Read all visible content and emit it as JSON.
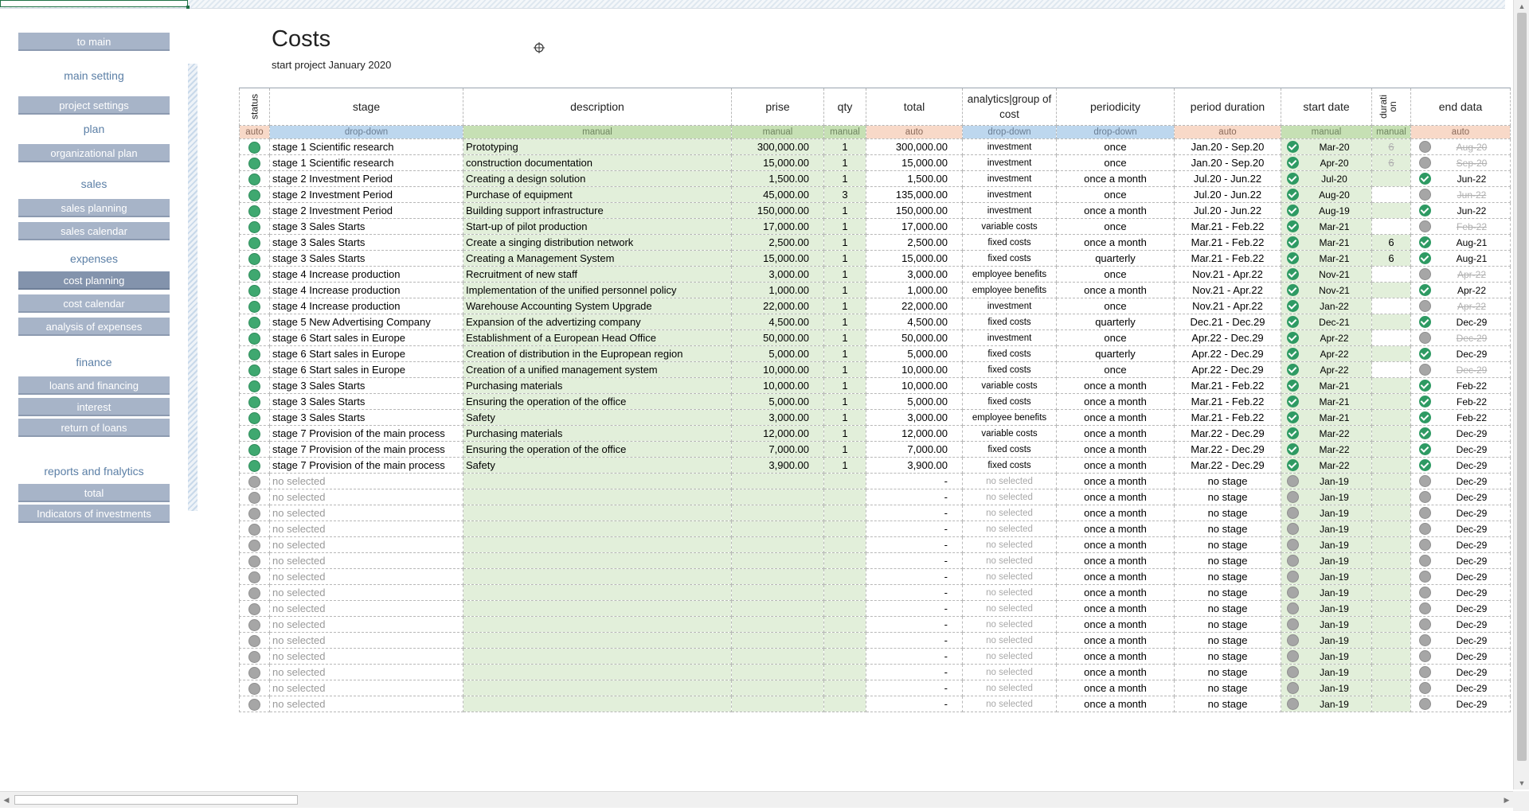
{
  "nav": {
    "to_main": "to main",
    "main_setting": "main setting",
    "project_settings": "project settings",
    "plan": "plan",
    "organizational_plan": "organizational plan",
    "sales": "sales",
    "sales_planning": "sales planning",
    "sales_calendar": "sales calendar",
    "expenses": "expenses",
    "cost_planning": "cost planning",
    "cost_calendar": "cost calendar",
    "analysis_of_expenses": "analysis of expenses",
    "finance": "finance",
    "loans_and_financing": "loans and financing",
    "interest": "interest",
    "return_of_loans": "return of loans",
    "reports": "reports and fnalytics",
    "total": "total",
    "indicators": "Indicators of investments"
  },
  "page": {
    "title": "Costs",
    "subtitle": "start project January 2020"
  },
  "columns": {
    "status": "status",
    "stage": "stage",
    "description": "description",
    "prise": "prise",
    "qty": "qty",
    "total": "total",
    "analytics": "analytics|group of cost",
    "periodicity": "periodicity",
    "period_duration": "period duration",
    "start_date": "start date",
    "duration": "durati on",
    "end_date": "end data"
  },
  "types": {
    "auto": "auto",
    "drop": "drop-down",
    "manual": "manual"
  },
  "colors": {
    "accent_nav": "#a7b4c8",
    "status_green": "#3fa870",
    "status_grey": "#a6a6a6",
    "manual_fill": "#e2efda",
    "auto_fill": "#f8d9c8",
    "drop_fill": "#bdd7ee"
  },
  "rows": [
    {
      "stage": "stage 1 Scientific research",
      "description": "Prototyping",
      "prise": "300,000.00",
      "qty": "1",
      "total": "300,000.00",
      "group": "investment",
      "periodicity": "once",
      "duration_range": "Jan.20 - Sep.20",
      "start": "Mar-20",
      "dur": "6",
      "end": "Aug-20",
      "end_struck": true,
      "dur_struck": true,
      "end_green": false
    },
    {
      "stage": "stage 1 Scientific research",
      "description": "construction documentation",
      "prise": "15,000.00",
      "qty": "1",
      "total": "15,000.00",
      "group": "investment",
      "periodicity": "once",
      "duration_range": "Jan.20 - Sep.20",
      "start": "Apr-20",
      "dur": "6",
      "end": "Sep-20",
      "end_struck": true,
      "dur_struck": true,
      "end_green": false
    },
    {
      "stage": "stage 2 Investment Period",
      "description": "Creating a design solution",
      "prise": "1,500.00",
      "qty": "1",
      "total": "1,500.00",
      "group": "investment",
      "periodicity": "once a month",
      "duration_range": "Jul.20 - Jun.22",
      "start": "Jul-20",
      "dur": "",
      "end": "Jun-22",
      "end_struck": false,
      "dur_struck": false,
      "end_green": true
    },
    {
      "stage": "stage 2 Investment Period",
      "description": "Purchase of equipment",
      "prise": "45,000.00",
      "qty": "3",
      "total": "135,000.00",
      "group": "investment",
      "periodicity": "once",
      "duration_range": "Jul.20 - Jun.22",
      "start": "Aug-20",
      "dur": "",
      "end": "Jun-22",
      "end_struck": true,
      "dur_struck": false,
      "end_green": false
    },
    {
      "stage": "stage 2 Investment Period",
      "description": "Building support infrastructure",
      "prise": "150,000.00",
      "qty": "1",
      "total": "150,000.00",
      "group": "investment",
      "periodicity": "once a month",
      "duration_range": "Jul.20 - Jun.22",
      "start": "Aug-19",
      "dur": "",
      "end": "Jun-22",
      "end_struck": false,
      "dur_struck": false,
      "end_green": true
    },
    {
      "stage": "stage 3 Sales Starts",
      "description": "Start-up of pilot production",
      "prise": "17,000.00",
      "qty": "1",
      "total": "17,000.00",
      "group": "variable costs",
      "periodicity": "once",
      "duration_range": "Mar.21 - Feb.22",
      "start": "Mar-21",
      "dur": "",
      "end": "Feb-22",
      "end_struck": true,
      "dur_struck": false,
      "end_green": false
    },
    {
      "stage": "stage 3 Sales Starts",
      "description": "Create a singing distribution network",
      "prise": "2,500.00",
      "qty": "1",
      "total": "2,500.00",
      "group": "fixed costs",
      "periodicity": "once a month",
      "duration_range": "Mar.21 - Feb.22",
      "start": "Mar-21",
      "dur": "6",
      "end": "Aug-21",
      "end_struck": false,
      "dur_struck": false,
      "end_green": true
    },
    {
      "stage": "stage 3 Sales Starts",
      "description": "Creating a Management System",
      "prise": "15,000.00",
      "qty": "1",
      "total": "15,000.00",
      "group": "fixed costs",
      "periodicity": "quarterly",
      "duration_range": "Mar.21 - Feb.22",
      "start": "Mar-21",
      "dur": "6",
      "end": "Aug-21",
      "end_struck": false,
      "dur_struck": false,
      "end_green": true
    },
    {
      "stage": "stage 4 Increase production",
      "description": "Recruitment of new staff",
      "prise": "3,000.00",
      "qty": "1",
      "total": "3,000.00",
      "group": "employee benefits",
      "periodicity": "once",
      "duration_range": "Nov.21 - Apr.22",
      "start": "Nov-21",
      "dur": "",
      "end": "Apr-22",
      "end_struck": true,
      "dur_struck": false,
      "end_green": false
    },
    {
      "stage": "stage 4 Increase production",
      "description": "Implementation of the unified personnel policy",
      "prise": "1,000.00",
      "qty": "1",
      "total": "1,000.00",
      "group": "employee benefits",
      "periodicity": "once a month",
      "duration_range": "Nov.21 - Apr.22",
      "start": "Nov-21",
      "dur": "",
      "end": "Apr-22",
      "end_struck": false,
      "dur_struck": false,
      "end_green": true
    },
    {
      "stage": "stage 4 Increase production",
      "description": "Warehouse Accounting System Upgrade",
      "prise": "22,000.00",
      "qty": "1",
      "total": "22,000.00",
      "group": "investment",
      "periodicity": "once",
      "duration_range": "Nov.21 - Apr.22",
      "start": "Jan-22",
      "dur": "",
      "end": "Apr-22",
      "end_struck": true,
      "dur_struck": false,
      "end_green": false
    },
    {
      "stage": "stage 5 New Advertising Company",
      "description": "Expansion of the advertizing company",
      "prise": "4,500.00",
      "qty": "1",
      "total": "4,500.00",
      "group": "fixed costs",
      "periodicity": "quarterly",
      "duration_range": "Dec.21 - Dec.29",
      "start": "Dec-21",
      "dur": "",
      "end": "Dec-29",
      "end_struck": false,
      "dur_struck": false,
      "end_green": true
    },
    {
      "stage": "stage 6 Start sales in Europe",
      "description": "Establishment of a European Head Office",
      "prise": "50,000.00",
      "qty": "1",
      "total": "50,000.00",
      "group": "investment",
      "periodicity": "once",
      "duration_range": "Apr.22 - Dec.29",
      "start": "Apr-22",
      "dur": "",
      "end": "Dec-29",
      "end_struck": true,
      "dur_struck": false,
      "end_green": false
    },
    {
      "stage": "stage 6 Start sales in Europe",
      "description": "Creation of distribution in the Eupropean region",
      "prise": "5,000.00",
      "qty": "1",
      "total": "5,000.00",
      "group": "fixed costs",
      "periodicity": "quarterly",
      "duration_range": "Apr.22 - Dec.29",
      "start": "Apr-22",
      "dur": "",
      "end": "Dec-29",
      "end_struck": false,
      "dur_struck": false,
      "end_green": true
    },
    {
      "stage": "stage 6 Start sales in Europe",
      "description": "Creation of a unified management system",
      "prise": "10,000.00",
      "qty": "1",
      "total": "10,000.00",
      "group": "fixed costs",
      "periodicity": "once",
      "duration_range": "Apr.22 - Dec.29",
      "start": "Apr-22",
      "dur": "",
      "end": "Dec-29",
      "end_struck": true,
      "dur_struck": false,
      "end_green": false
    },
    {
      "stage": "stage 3 Sales Starts",
      "description": "Purchasing materials",
      "prise": "10,000.00",
      "qty": "1",
      "total": "10,000.00",
      "group": "variable costs",
      "periodicity": "once a month",
      "duration_range": "Mar.21 - Feb.22",
      "start": "Mar-21",
      "dur": "",
      "end": "Feb-22",
      "end_struck": false,
      "dur_struck": false,
      "end_green": true
    },
    {
      "stage": "stage 3 Sales Starts",
      "description": "Ensuring the operation of the office",
      "prise": "5,000.00",
      "qty": "1",
      "total": "5,000.00",
      "group": "fixed costs",
      "periodicity": "once a month",
      "duration_range": "Mar.21 - Feb.22",
      "start": "Mar-21",
      "dur": "",
      "end": "Feb-22",
      "end_struck": false,
      "dur_struck": false,
      "end_green": true
    },
    {
      "stage": "stage 3 Sales Starts",
      "description": "Safety",
      "prise": "3,000.00",
      "qty": "1",
      "total": "3,000.00",
      "group": "employee benefits",
      "periodicity": "once a month",
      "duration_range": "Mar.21 - Feb.22",
      "start": "Mar-21",
      "dur": "",
      "end": "Feb-22",
      "end_struck": false,
      "dur_struck": false,
      "end_green": true
    },
    {
      "stage": "stage 7 Provision of the main process",
      "description": "Purchasing materials",
      "prise": "12,000.00",
      "qty": "1",
      "total": "12,000.00",
      "group": "variable costs",
      "periodicity": "once a month",
      "duration_range": "Mar.22 - Dec.29",
      "start": "Mar-22",
      "dur": "",
      "end": "Dec-29",
      "end_struck": false,
      "dur_struck": false,
      "end_green": true
    },
    {
      "stage": "stage 7 Provision of the main process",
      "description": "Ensuring the operation of the office",
      "prise": "7,000.00",
      "qty": "1",
      "total": "7,000.00",
      "group": "fixed costs",
      "periodicity": "once a month",
      "duration_range": "Mar.22 - Dec.29",
      "start": "Mar-22",
      "dur": "",
      "end": "Dec-29",
      "end_struck": false,
      "dur_struck": false,
      "end_green": true
    },
    {
      "stage": "stage 7 Provision of the main process",
      "description": "Safety",
      "prise": "3,900.00",
      "qty": "1",
      "total": "3,900.00",
      "group": "fixed costs",
      "periodicity": "once a month",
      "duration_range": "Mar.22 - Dec.29",
      "start": "Mar-22",
      "dur": "",
      "end": "Dec-29",
      "end_struck": false,
      "dur_struck": false,
      "end_green": true
    }
  ],
  "empty_row": {
    "stage": "no selected",
    "total": "-",
    "group": "no selected",
    "periodicity": "once a month",
    "duration_range": "no stage",
    "start": "Jan-19",
    "end": "Dec-29",
    "count": 15
  }
}
